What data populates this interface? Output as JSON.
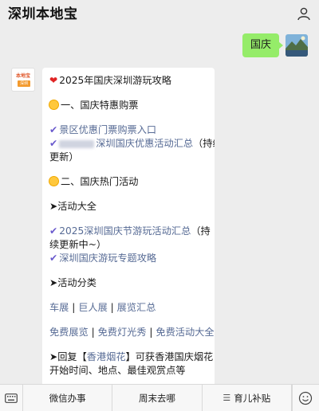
{
  "header": {
    "title": "深圳本地宝"
  },
  "outgoing": {
    "text": "国庆"
  },
  "bot_avatar": {
    "top": "本地宝",
    "bottom": "深圳"
  },
  "message": {
    "title": "2025年国庆深圳游玩攻略",
    "sec1": "一、国庆特惠购票",
    "link1": "景区优惠门票购票入口",
    "link2": "深圳国庆优惠活动汇总",
    "link2_suffix_1": "（持续",
    "link2_suffix_2": "更新）",
    "sec2": "二、国庆热门活动",
    "activities_all": "➤活动大全",
    "link3_line1": "2025深圳国庆节游玩活动汇总",
    "link3_suffix": "（持",
    "link3_line2": "续更新中~）",
    "link4": "深圳国庆游玩专题攻略",
    "activities_cat": "➤活动分类",
    "cat1": "车展",
    "cat2": "巨人展",
    "cat3": "展览汇总",
    "free1": "免费展览",
    "free2": "免费灯光秀",
    "free3": "免费活动大全",
    "reply_pre": "➤回复【",
    "reply_kw": "香港烟花",
    "reply_post": "】可获香港国庆烟花",
    "reply_line2": "开始时间、地点、最佳观赏点等",
    "sep": " | "
  },
  "menu": {
    "items": [
      "微信办事",
      "周末去哪",
      "育儿补贴"
    ],
    "keyboard_icon": "keyboard-icon",
    "emoji_icon": "emoji-icon"
  }
}
